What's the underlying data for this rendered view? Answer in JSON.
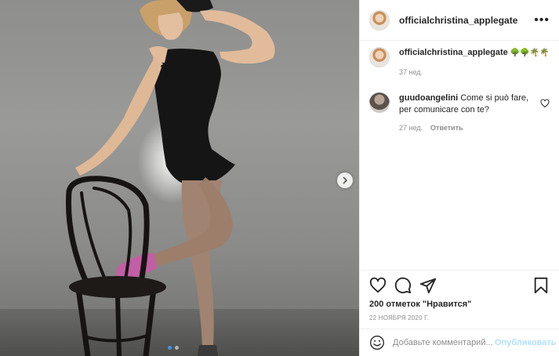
{
  "post": {
    "author": {
      "username": "officialchristina_applegate"
    },
    "caption": {
      "username": "officialchristina_applegate",
      "emojis": "🌳🌳🌴🌴",
      "age": "37 нед."
    },
    "comments": [
      {
        "username": "guudoangelini",
        "text": "Come si può fare, per comunicare con te?",
        "age": "27 нед.",
        "reply_label": "Ответить"
      }
    ],
    "likes_text": "200 отметок \"Нравится\"",
    "date": "22 НОЯБРЯ 2020 Г.",
    "add_comment": {
      "placeholder": "Добавьте комментарий...",
      "publish_label": "Опубликовать"
    },
    "carousel": {
      "total": 2,
      "active": 1
    }
  },
  "icons": {
    "more": "more-options-icon",
    "next": "chevron-right-icon",
    "like": "heart-icon",
    "comment": "comment-bubble-icon",
    "share": "paper-plane-icon",
    "save": "bookmark-icon",
    "emoji": "smiley-icon"
  },
  "colors": {
    "link_blue_disabled": "#b2dffc",
    "meta_gray": "#8e8e8e",
    "text": "#262626",
    "carousel_active": "#3897f0"
  }
}
